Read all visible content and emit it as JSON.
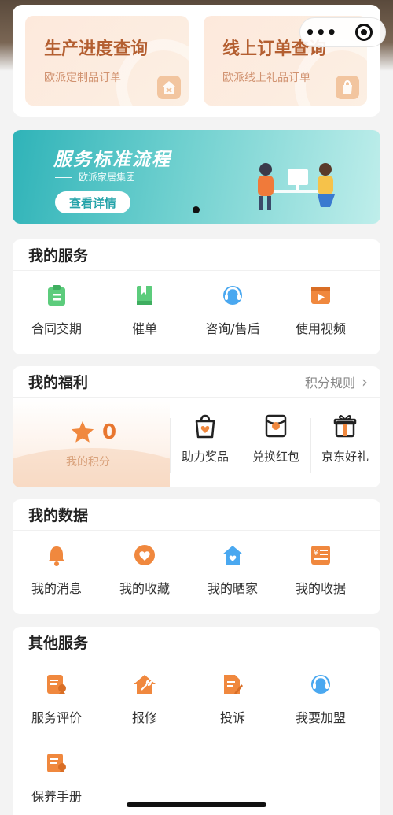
{
  "capsule": {
    "more_label": "•••"
  },
  "query_cards": [
    {
      "title": "生产进度查询",
      "subtitle": "欧派定制品订单"
    },
    {
      "title": "线上订单查询",
      "subtitle": "欧派线上礼品订单"
    }
  ],
  "banner": {
    "title": "服务标准流程",
    "subtitle": "欧派家居集团",
    "button_label": "查看详情"
  },
  "my_services": {
    "title": "我的服务",
    "items": [
      {
        "label": "合同交期",
        "icon": "contract-clipboard-icon"
      },
      {
        "label": "催单",
        "icon": "bookmark-book-icon"
      },
      {
        "label": "咨询/售后",
        "icon": "headset-support-icon"
      },
      {
        "label": "使用视频",
        "icon": "video-play-icon"
      }
    ]
  },
  "my_welfare": {
    "title": "我的福利",
    "rules_label": "积分规则",
    "points_value": "0",
    "points_label": "我的积分",
    "items": [
      {
        "label": "助力奖品",
        "icon": "shopping-bag-heart-icon"
      },
      {
        "label": "兑换红包",
        "icon": "red-envelope-icon"
      },
      {
        "label": "京东好礼",
        "icon": "gift-box-icon"
      }
    ]
  },
  "my_data": {
    "title": "我的数据",
    "items": [
      {
        "label": "我的消息",
        "icon": "bell-icon"
      },
      {
        "label": "我的收藏",
        "icon": "heart-favorite-icon"
      },
      {
        "label": "我的晒家",
        "icon": "house-heart-icon"
      },
      {
        "label": "我的收据",
        "icon": "receipt-icon"
      }
    ]
  },
  "other_services": {
    "title": "其他服务",
    "items": [
      {
        "label": "服务评价",
        "icon": "review-document-icon"
      },
      {
        "label": "报修",
        "icon": "repair-wrench-house-icon"
      },
      {
        "label": "投诉",
        "icon": "complaint-document-icon"
      },
      {
        "label": "我要加盟",
        "icon": "headset-join-icon"
      },
      {
        "label": "保养手册",
        "icon": "maintenance-manual-icon"
      }
    ]
  },
  "colors": {
    "accent_orange": "#f0883e",
    "service_green": "#5ccc7c",
    "service_blue": "#4aa8f0",
    "banner_teal": "#2fb3b8"
  }
}
